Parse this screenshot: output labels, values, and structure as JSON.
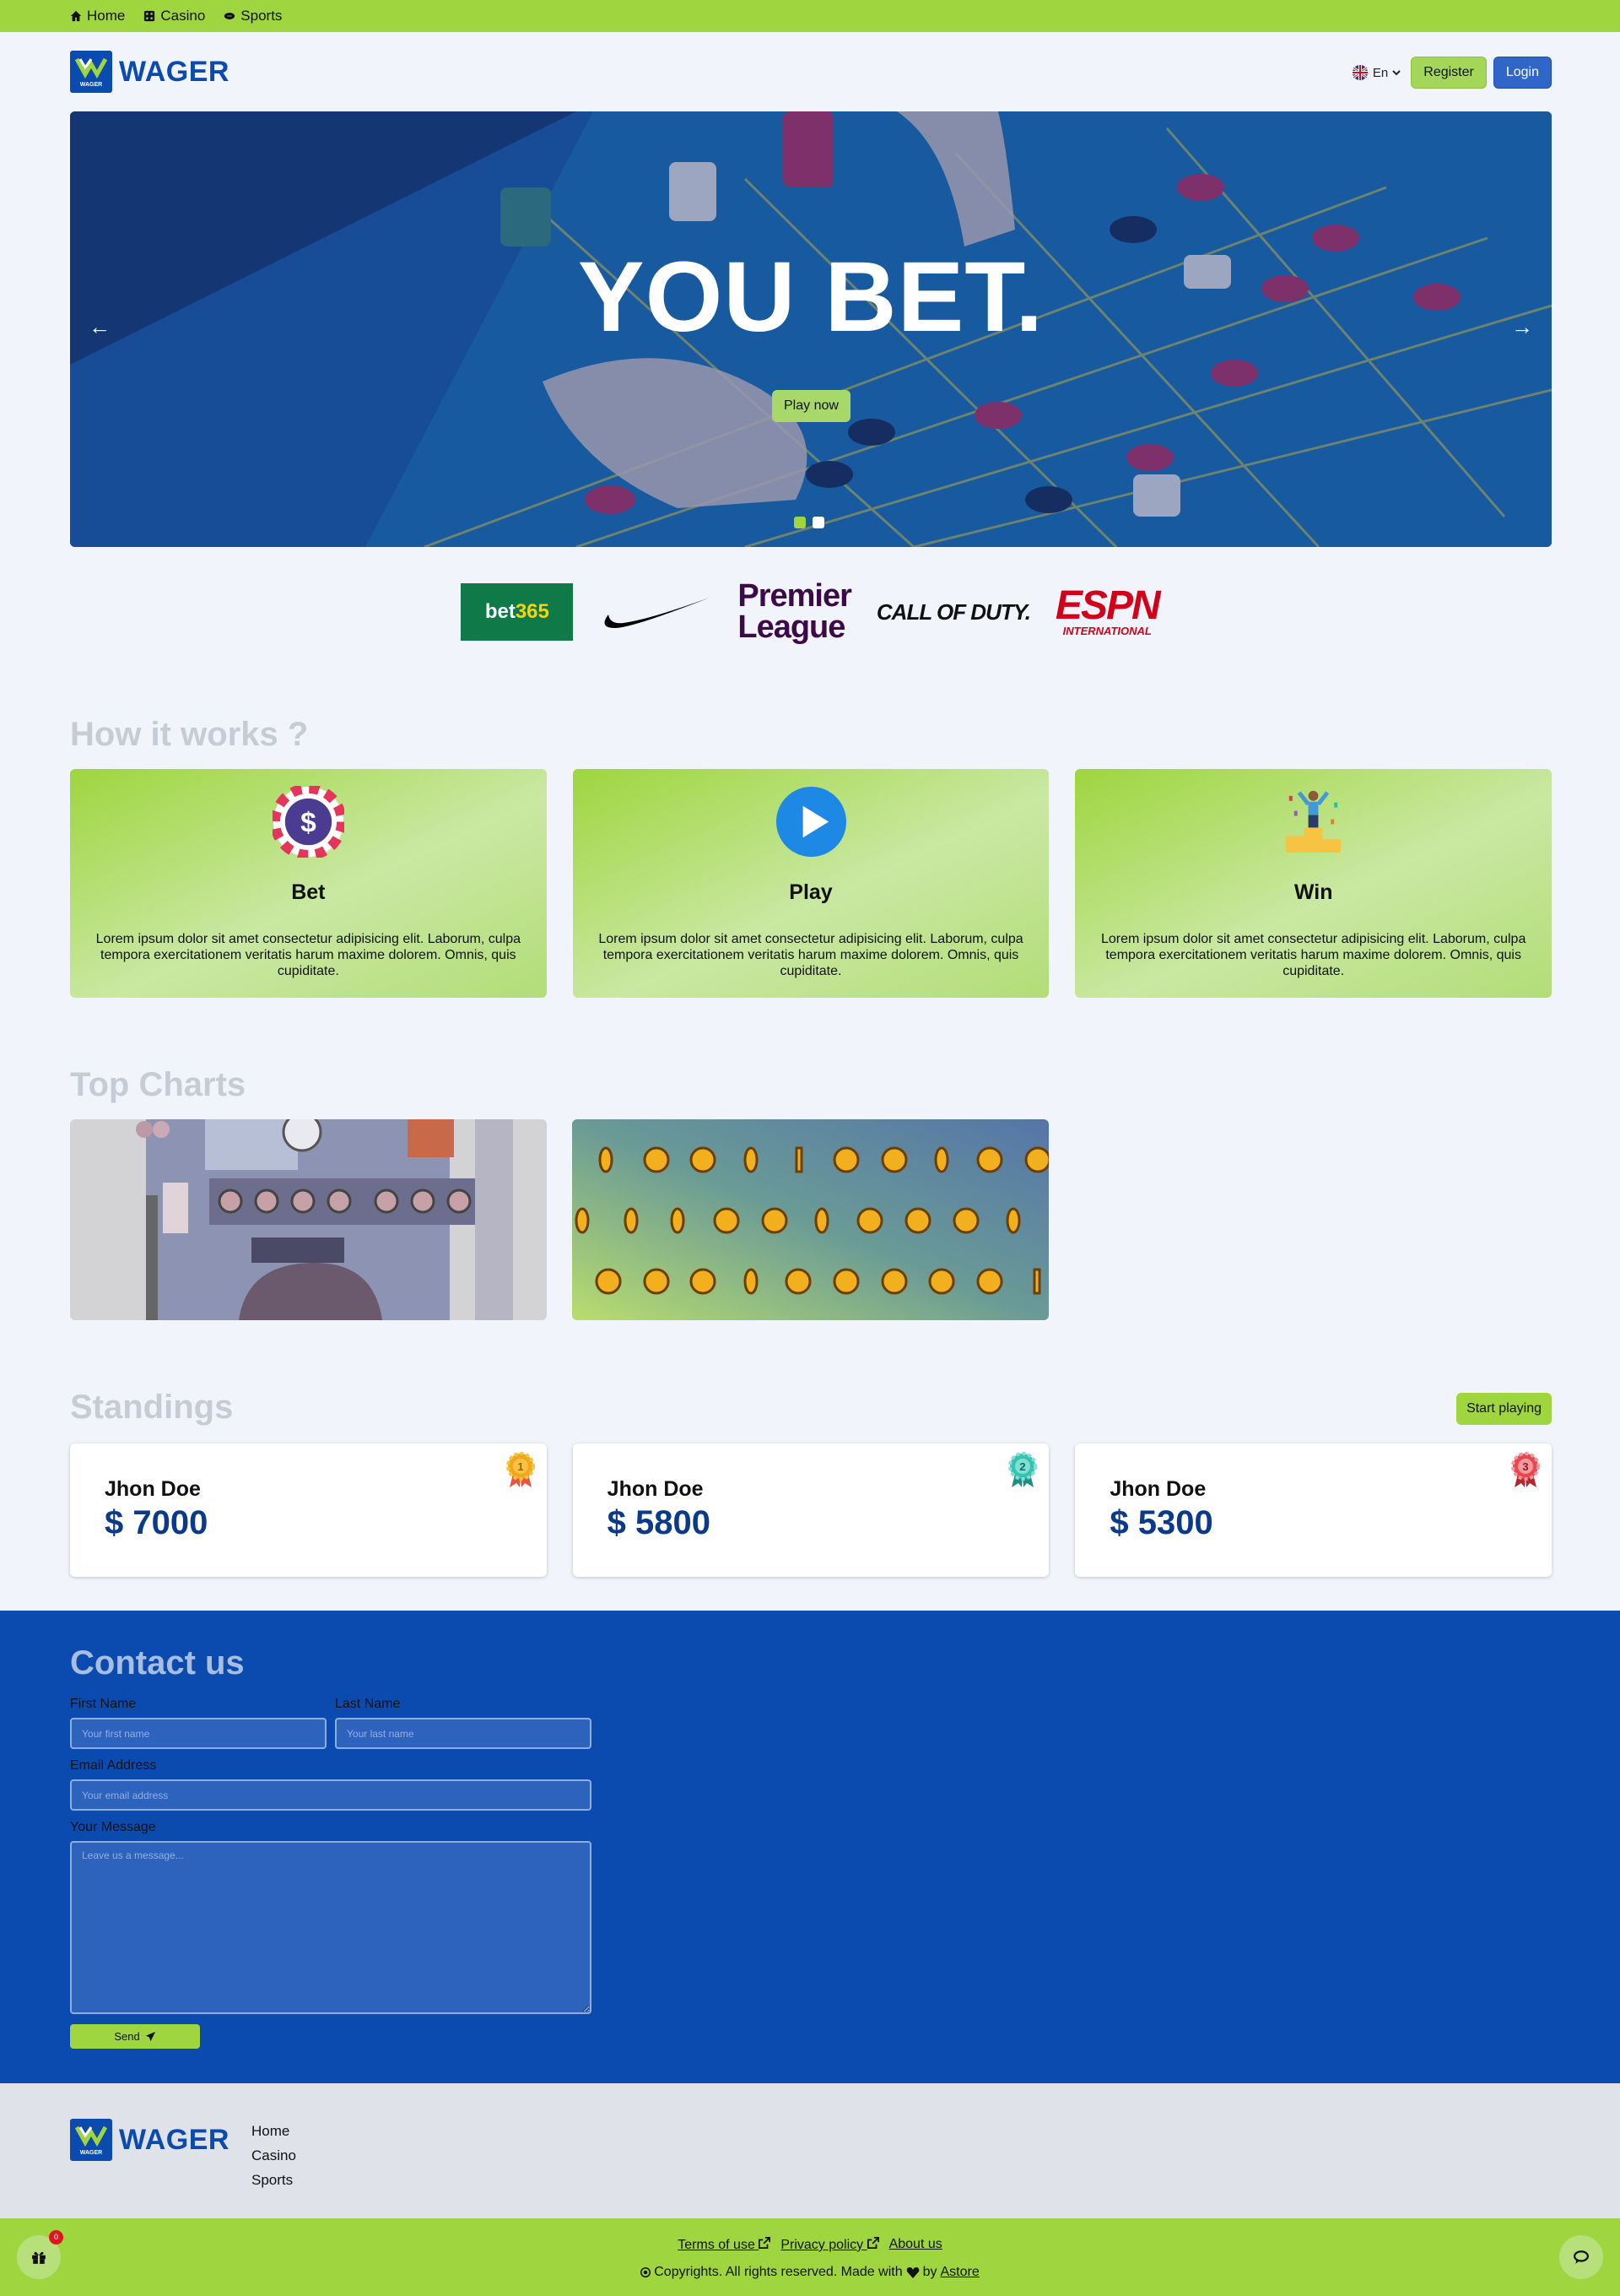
{
  "topnav": {
    "home": "Home",
    "casino": "Casino",
    "sports": "Sports"
  },
  "header": {
    "brand": "WAGER",
    "logo_text": "WAGER",
    "lang": "En",
    "register": "Register",
    "login": "Login"
  },
  "hero": {
    "title": "YOU BET.",
    "cta": "Play now",
    "slides": 2,
    "active_slide": 1
  },
  "partners": {
    "bet365_a": "bet",
    "bet365_b": "365",
    "premier_1": "Premier",
    "premier_2": "League",
    "cod": "CALL OF DUTY.",
    "espn": "ESPN",
    "espn_sub": "INTERNATIONAL"
  },
  "how": {
    "title": "How it works ?",
    "cards": [
      {
        "title": "Bet",
        "text": "Lorem ipsum dolor sit amet consectetur adipisicing elit. Laborum, culpa tempora exercitationem veritatis harum maxime dolorem. Omnis, quis cupiditate."
      },
      {
        "title": "Play",
        "text": "Lorem ipsum dolor sit amet consectetur adipisicing elit. Laborum, culpa tempora exercitationem veritatis harum maxime dolorem. Omnis, quis cupiditate."
      },
      {
        "title": "Win",
        "text": "Lorem ipsum dolor sit amet consectetur adipisicing elit. Laborum, culpa tempora exercitationem veritatis harum maxime dolorem. Omnis, quis cupiditate."
      }
    ]
  },
  "top_charts": {
    "title": "Top Charts"
  },
  "standings": {
    "title": "Standings",
    "cta": "Start playing",
    "rows": [
      {
        "name": "Jhon Doe",
        "amount": "$ 7000",
        "rank": "1"
      },
      {
        "name": "Jhon Doe",
        "amount": "$ 5800",
        "rank": "2"
      },
      {
        "name": "Jhon Doe",
        "amount": "$ 5300",
        "rank": "3"
      }
    ]
  },
  "contact": {
    "title": "Contact us",
    "first_label": "First Name",
    "first_placeholder": "Your first name",
    "last_label": "Last Name",
    "last_placeholder": "Your last name",
    "email_label": "Email Address",
    "email_placeholder": "Your email address",
    "message_label": "Your Message",
    "message_placeholder": "Leave us a message...",
    "send": "Send"
  },
  "footer": {
    "brand": "WAGER",
    "links": [
      "Home",
      "Casino",
      "Sports"
    ],
    "terms": "Terms of use",
    "privacy": "Privacy policy",
    "about": "About us",
    "copyright": "Copyrights. All rights reserved. Made with",
    "by": "by",
    "author": "Astore",
    "gift_count": "0"
  },
  "colors": {
    "green": "#9fd53f",
    "blue": "#0b4aaf",
    "bg": "#f1f5fb",
    "footer": "#dfe3e9"
  }
}
